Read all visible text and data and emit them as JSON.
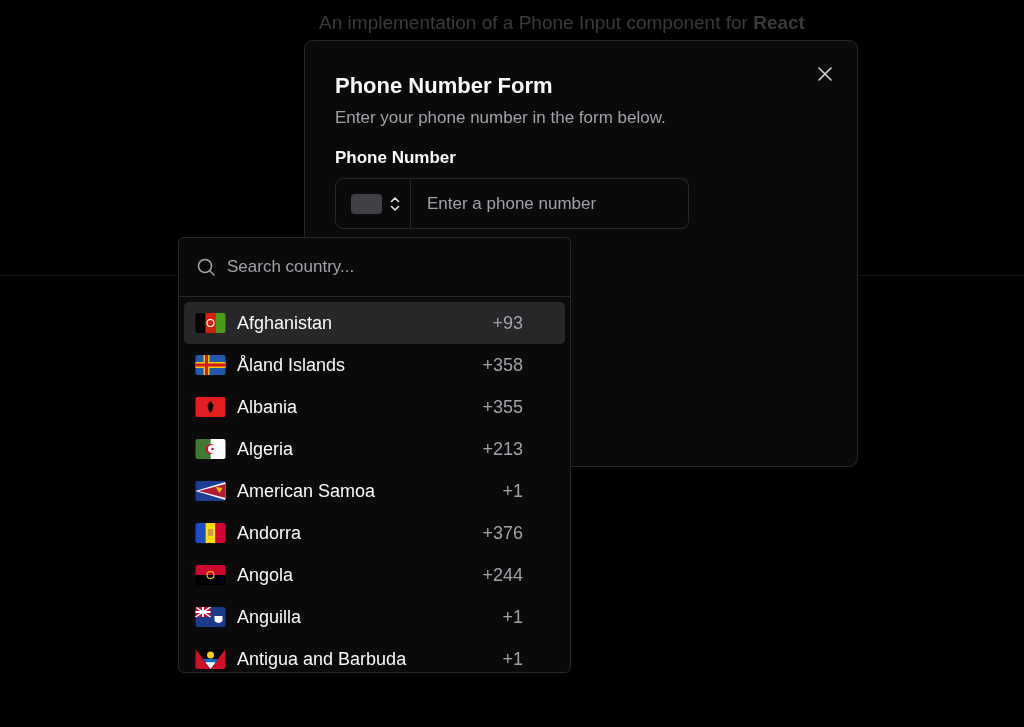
{
  "background_text": "An implementation of a Phone Input component for **React**",
  "dialog": {
    "title": "Phone Number Form",
    "description": "Enter your phone number in the form below.",
    "field_label": "Phone Number",
    "phone_input": {
      "placeholder": "Enter a phone number"
    }
  },
  "country_picker": {
    "search": {
      "placeholder": "Search country..."
    },
    "countries": [
      {
        "name": "Afghanistan",
        "code": "+93",
        "selected": true
      },
      {
        "name": "Åland Islands",
        "code": "+358",
        "selected": false
      },
      {
        "name": "Albania",
        "code": "+355",
        "selected": false
      },
      {
        "name": "Algeria",
        "code": "+213",
        "selected": false
      },
      {
        "name": "American Samoa",
        "code": "+1",
        "selected": false
      },
      {
        "name": "Andorra",
        "code": "+376",
        "selected": false
      },
      {
        "name": "Angola",
        "code": "+244",
        "selected": false
      },
      {
        "name": "Anguilla",
        "code": "+1",
        "selected": false
      },
      {
        "name": "Antigua and Barbuda",
        "code": "+1",
        "selected": false
      }
    ]
  }
}
